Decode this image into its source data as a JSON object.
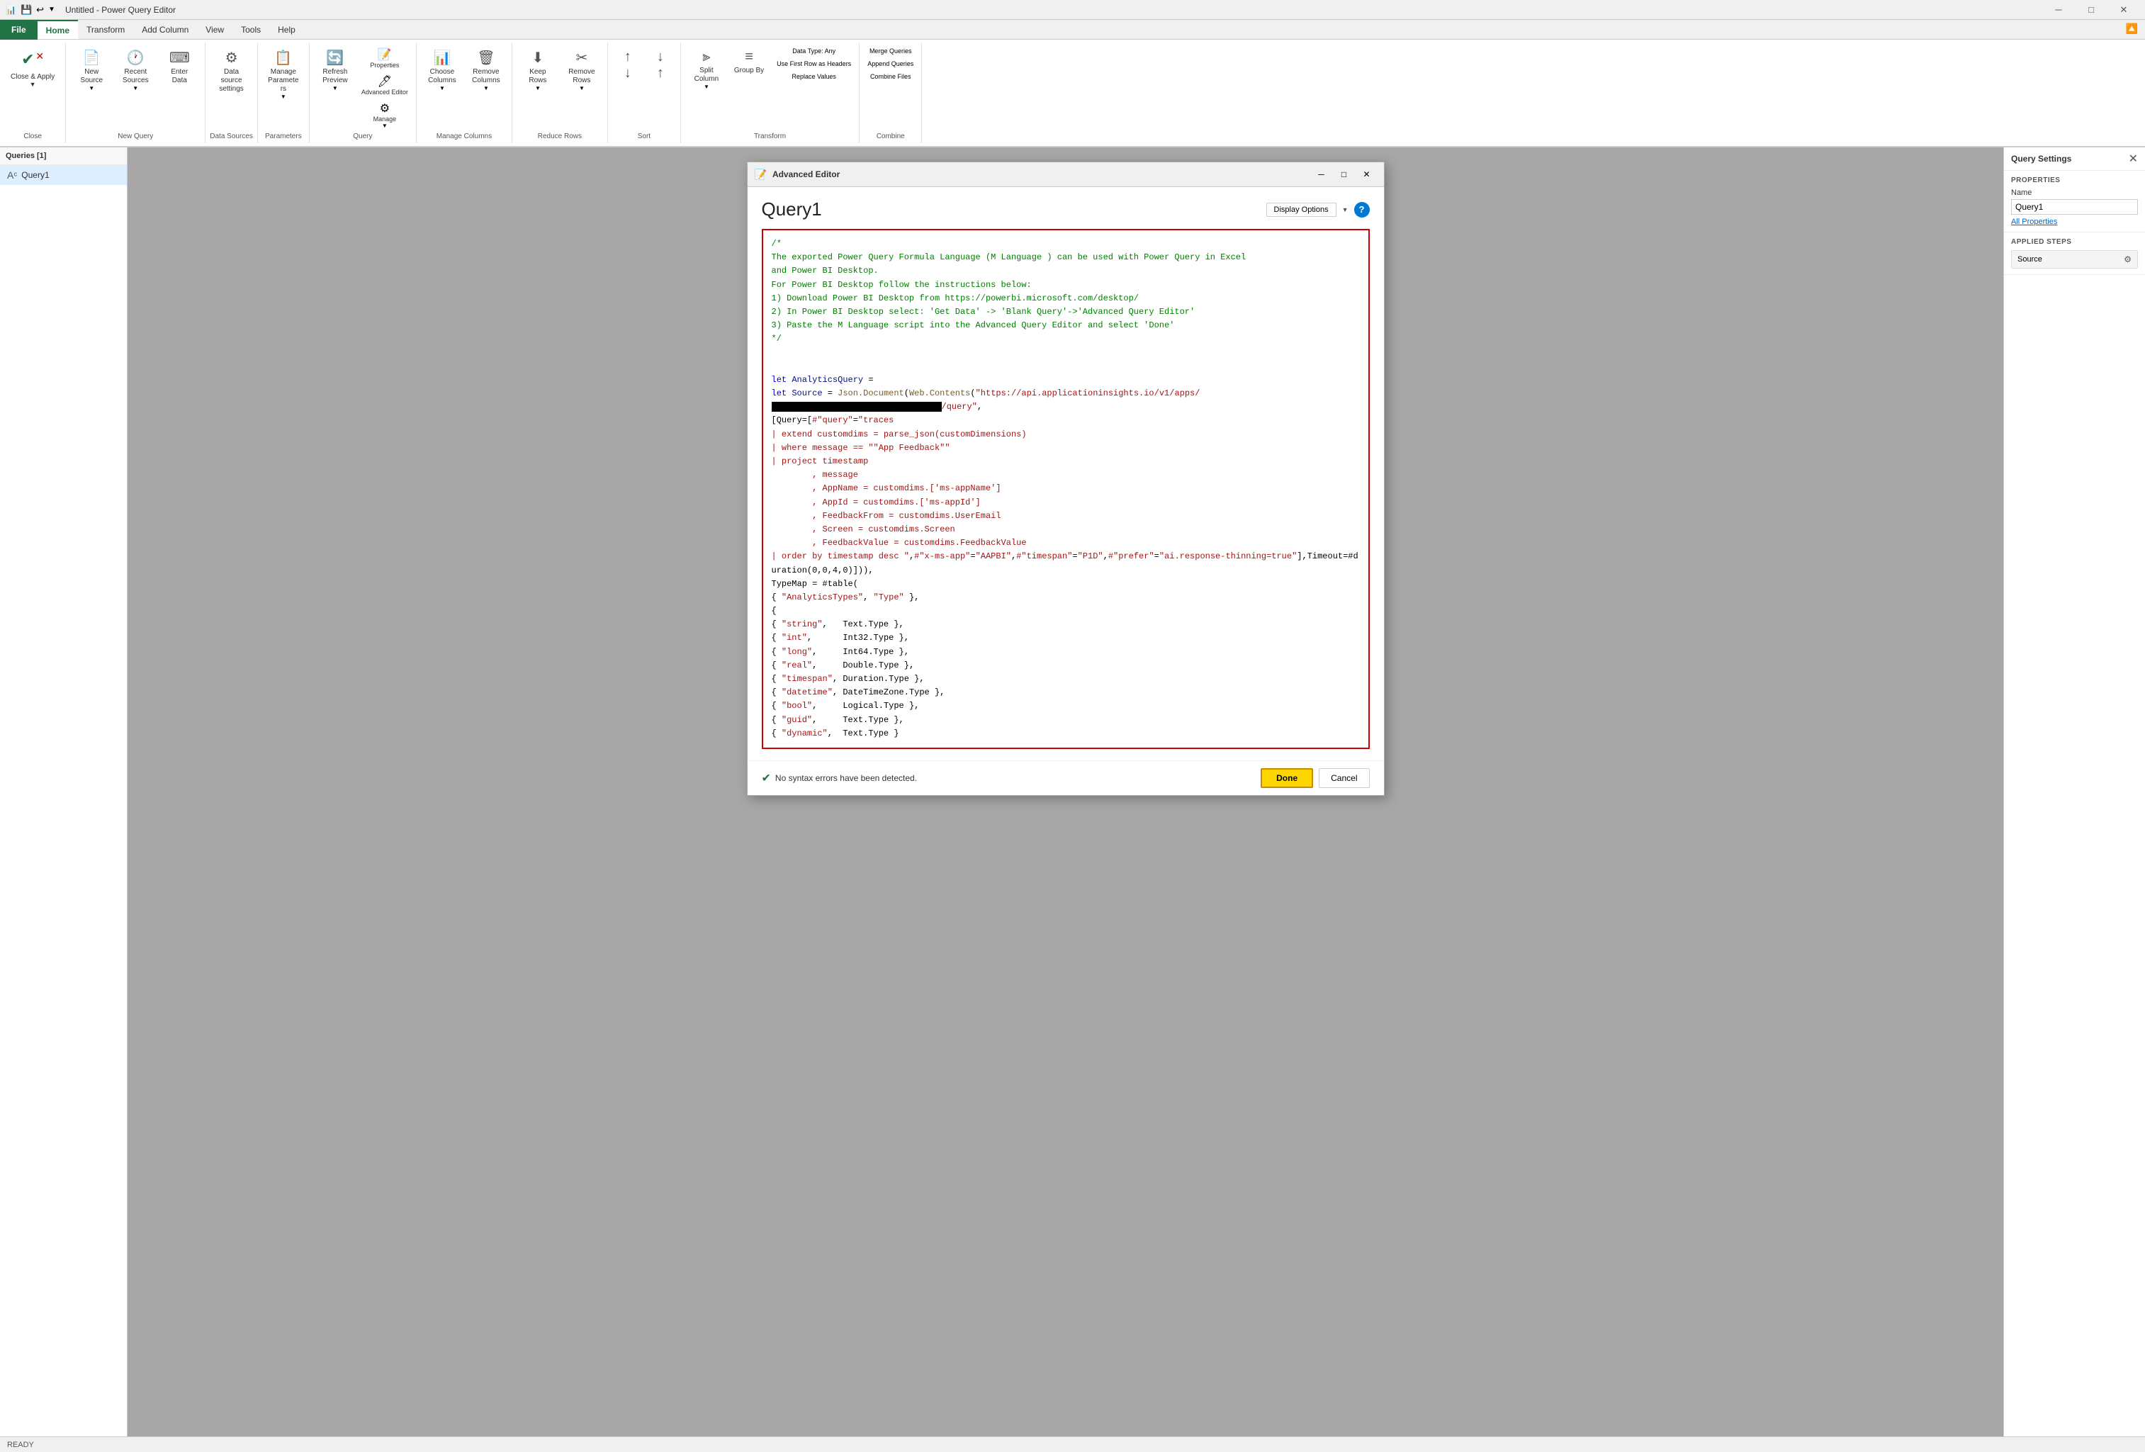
{
  "titlebar": {
    "title": "Untitled - Power Query Editor",
    "icon": "📊"
  },
  "ribbon_tabs": [
    "File",
    "Home",
    "Transform",
    "Add Column",
    "View",
    "Tools",
    "Help"
  ],
  "active_tab": "Home",
  "ribbon_groups": {
    "close_group": {
      "label": "Close",
      "close_apply_label": "Close &\nApply",
      "close_label": "Close"
    },
    "new_query_group": {
      "label": "New Query",
      "new_source_label": "New\nSource",
      "recent_sources_label": "Recent\nSources",
      "enter_data_label": "Enter\nData"
    },
    "data_sources_group": {
      "label": "Data Sources",
      "data_source_settings_label": "Data source\nsettings"
    },
    "parameters_group": {
      "label": "Parameters",
      "manage_params_label": "Manage\nParameters"
    },
    "query_group": {
      "label": "Query",
      "properties_label": "Properties",
      "advanced_editor_label": "Advanced Editor",
      "manage_label": "Manage",
      "refresh_preview_label": "Refresh\nPreview"
    },
    "manage_columns_group": {
      "label": "Manage Columns",
      "choose_columns_label": "Choose\nColumns",
      "remove_columns_label": "Remove\nColumns"
    },
    "reduce_rows_group": {
      "label": "Reduce Rows",
      "keep_rows_label": "Keep\nRows",
      "remove_rows_label": "Remove\nRows"
    },
    "sort_group": {
      "label": "Sort",
      "sort_items": [
        "↑↓",
        "↓↑"
      ]
    },
    "transform_group": {
      "label": "Transform",
      "data_type_label": "Data Type: Any",
      "first_row_label": "Use First Row as Headers",
      "replace_values_label": "Replace Values",
      "split_column_label": "Split\nColumn",
      "group_by_label": "Group\nBy"
    },
    "combine_group": {
      "label": "Combine",
      "merge_queries_label": "Merge Queries",
      "append_queries_label": "Append Queries",
      "combine_files_label": "Combine Files"
    }
  },
  "queries_panel": {
    "title": "Queries [1]",
    "items": [
      {
        "name": "Query1",
        "icon": "Aᶜ"
      }
    ]
  },
  "query_settings": {
    "title": "Query Settings",
    "properties_section": "PROPERTIES",
    "name_label": "Name",
    "name_value": "Query1",
    "all_props_label": "All Properties",
    "applied_steps_label": "APPLIED STEPS",
    "steps": [
      "Source"
    ]
  },
  "modal": {
    "title": "Advanced Editor",
    "icon": "📝",
    "query_name": "Query1",
    "display_options_label": "Display Options",
    "help_label": "?",
    "code_lines": [
      "/*",
      "The exported Power Query Formula Language (M Language ) can be used with Power Query in Excel",
      "and Power BI Desktop.",
      "For Power BI Desktop follow the instructions below:",
      "1) Download Power BI Desktop from https://powerbi.microsoft.com/desktop/",
      "2) In Power BI Desktop select: 'Get Data' -> 'Blank Query'->'Advanced Query Editor'",
      "3) Paste the M Language script into the Advanced Query Editor and select 'Done'",
      "*/",
      "",
      "",
      "let AnalyticsQuery =",
      "let Source = Json.Document(Web.Contents(\"https://api.applicationinsights.io/v1/apps/[REDACTED]/query\",",
      "[Query=[#\"query\"=\"traces",
      "| extend customdims = parse_json(customDimensions)",
      "| where message == \"\"App Feedback\"\"",
      "| project timestamp",
      "        , message",
      "        , AppName = customdims.['ms-appName']",
      "        , AppId = customdims.['ms-appId']",
      "        , FeedbackFrom = customdims.UserEmail",
      "        , Screen = customdims.Screen",
      "        , FeedbackValue = customdims.FeedbackValue",
      "| order by timestamp desc \",#\"x-ms-app\"=\"AAPBI\",#\"timespan\"=\"P1D\",#\"prefer\"=\"ai.response-thinning=true\"],Timeout=#duration(0,0,4,0)])),",
      "TypeMap = #table(",
      "{ \"AnalyticsTypes\", \"Type\" },",
      "{",
      "{ \"string\",   Text.Type },",
      "{ \"int\",      Int32.Type },",
      "{ \"long\",     Int64.Type },",
      "{ \"real\",     Double.Type },",
      "{ \"timespan\", Duration.Type },",
      "{ \"datetime\", DateTimeZone.Type },",
      "{ \"bool\",     Logical.Type },",
      "{ \"guid\",     Text.Type },",
      "{ \"dynamic\",  Text.Type }"
    ],
    "no_errors_text": "No syntax errors have been detected.",
    "done_label": "Done",
    "cancel_label": "Cancel"
  },
  "status_bar": {
    "text": "READY"
  }
}
